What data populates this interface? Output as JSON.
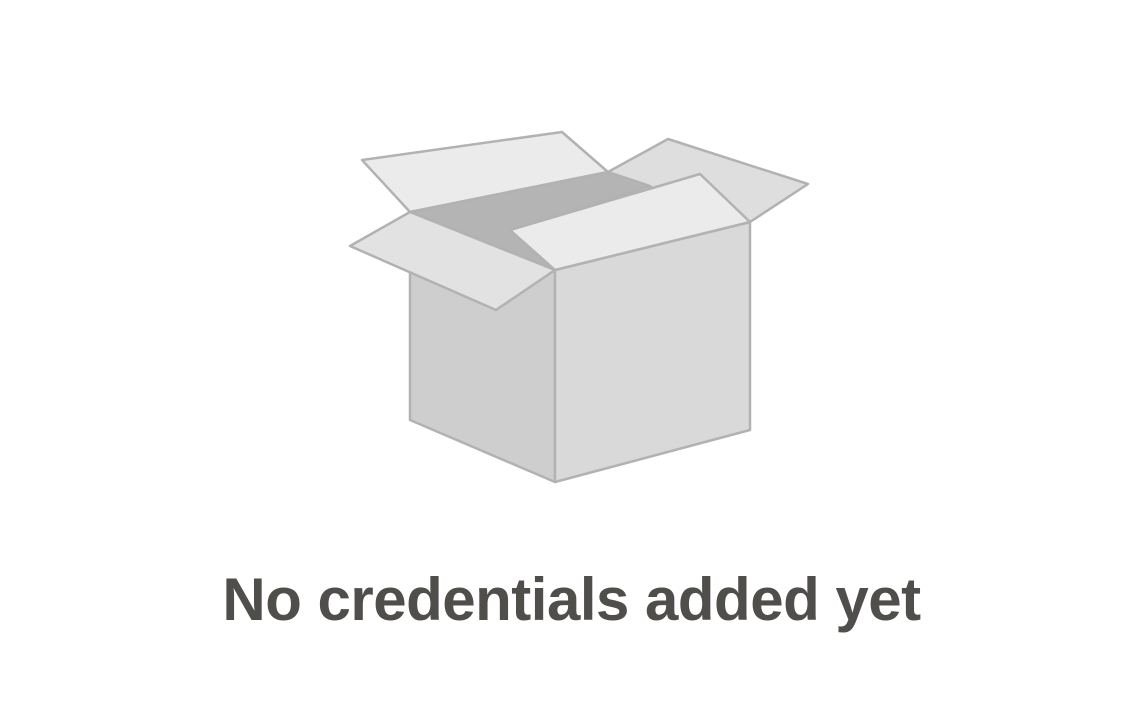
{
  "empty_state": {
    "illustration_icon": "open-box-icon",
    "title": "No credentials added yet"
  },
  "colors": {
    "background": "#ffffff",
    "title_text": "#504e4b",
    "box_stroke": "#b2b2b2",
    "box_front": "#d9d9d9",
    "box_side": "#cecece",
    "box_inside": "#b4b4b4",
    "box_flap": "#ebebeb"
  }
}
